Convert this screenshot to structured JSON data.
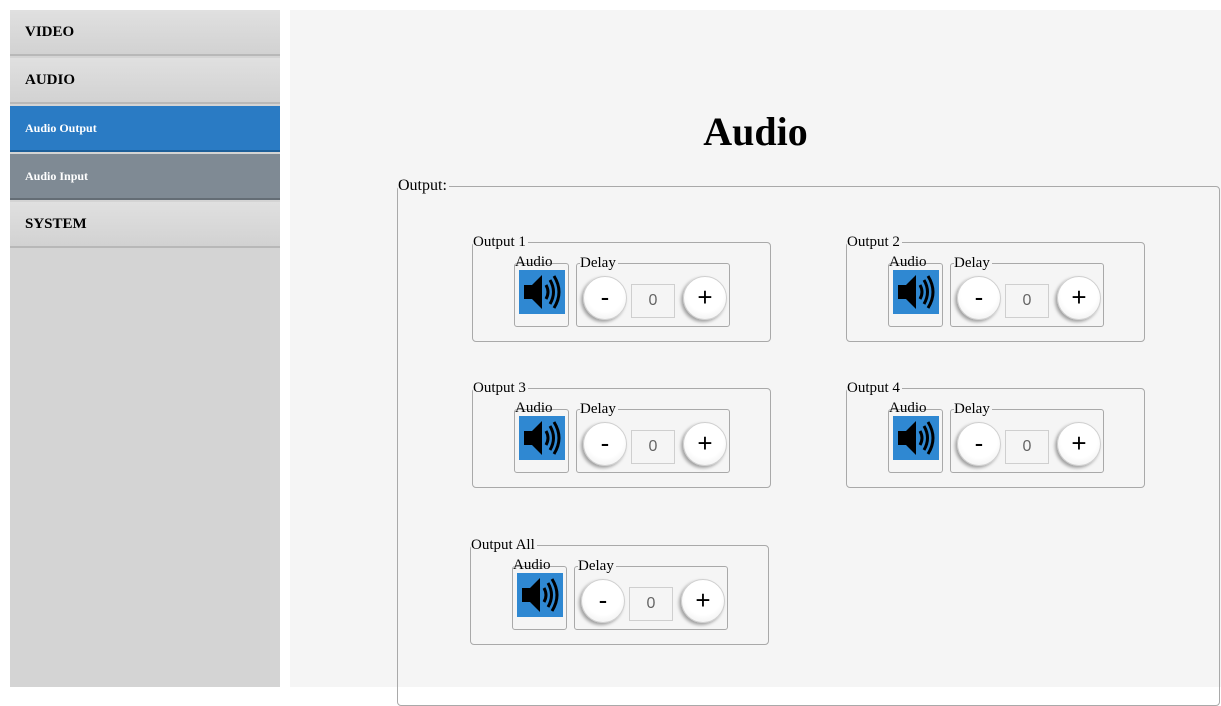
{
  "sidebar": {
    "items": [
      {
        "label": "VIDEO"
      },
      {
        "label": "AUDIO"
      },
      {
        "label": "Audio Output",
        "active": true
      },
      {
        "label": "Audio Input"
      },
      {
        "label": "SYSTEM"
      }
    ]
  },
  "page": {
    "title": "Audio",
    "output_legend": "Output:"
  },
  "outputs": [
    {
      "name": "Output 1",
      "audio_label": "Audio",
      "delay_label": "Delay",
      "minus": "-",
      "plus": "+",
      "delay_value": "0"
    },
    {
      "name": "Output 2",
      "audio_label": "Audio",
      "delay_label": "Delay",
      "minus": "-",
      "plus": "+",
      "delay_value": "0"
    },
    {
      "name": "Output 3",
      "audio_label": "Audio",
      "delay_label": "Delay",
      "minus": "-",
      "plus": "+",
      "delay_value": "0"
    },
    {
      "name": "Output 4",
      "audio_label": "Audio",
      "delay_label": "Delay",
      "minus": "-",
      "plus": "+",
      "delay_value": "0"
    },
    {
      "name": "Output All",
      "audio_label": "Audio",
      "delay_label": "Delay",
      "minus": "-",
      "plus": "+",
      "delay_value": "0"
    }
  ],
  "icons": {
    "speaker": "speaker-icon"
  },
  "colors": {
    "active_nav": "#2a7bc4",
    "sub_nav": "#7f8a94",
    "speaker_bg": "#2f88d2"
  }
}
